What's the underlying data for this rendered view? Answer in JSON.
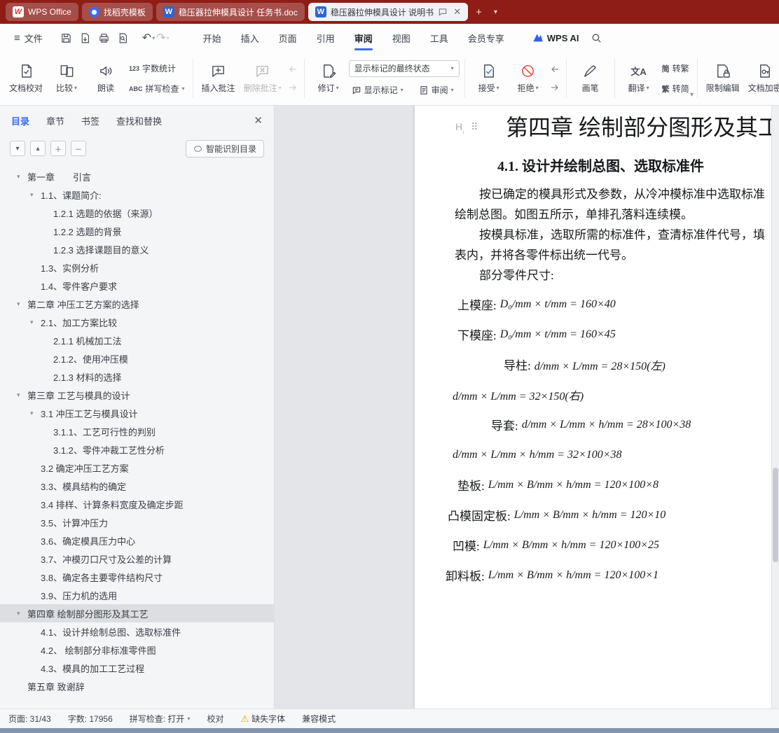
{
  "colors": {
    "titlebar": "#8e1d16",
    "accent_blue": "#3a6df0",
    "reject_red": "#e5443c",
    "selected_toc_bg": "#dcdee1",
    "warning_yellow": "#f0a500"
  },
  "titlebar": {
    "home_label": "WPS Office",
    "tabs": [
      "找稻壳模板",
      "稳压器拉伸模具设计 任务书.doc",
      "稳压器拉伸模具设计 说明书"
    ]
  },
  "menubar": {
    "file_label": "文件",
    "tabs": [
      "开始",
      "插入",
      "页面",
      "引用",
      "审阅",
      "视图",
      "工具",
      "会员专享"
    ],
    "wps_ai_label": "WPS AI"
  },
  "ribbon": {
    "doc_proof": "文档校对",
    "compare": "比较",
    "read_aloud": "朗读",
    "word_count_icon": "123",
    "word_count": "字数统计",
    "spell_icon": "ABC",
    "spell_check": "拼写检查",
    "insert_comment": "插入批注",
    "delete_comment": "删除批注",
    "track_changes": "修订",
    "markup_state": "显示标记的最终状态",
    "show_markup": "显示标记",
    "review": "审阅",
    "accept": "接受",
    "reject": "拒绝",
    "pen": "画笔",
    "translate_icon": "文A",
    "translate": "翻译",
    "jian": "简",
    "to_traditional": "转繁",
    "fan": "繁",
    "to_simplified": "转简",
    "restrict_edit": "限制编辑",
    "doc_encrypt": "文档加密"
  },
  "sidebar": {
    "tabs": [
      "目录",
      "章节",
      "书签",
      "查找和替换"
    ],
    "smart_toc_label": "智能识别目录",
    "toc": [
      "第一章　　引言",
      "1.1、课题简介:",
      "1.2.1 选题的依据（来源）",
      "1.2.2 选题的背景",
      "1.2.3 选择课题目的意义",
      "1.3、实例分析",
      "1.4、零件客户要求",
      "第二章 冲压工艺方案的选择",
      "2.1、加工方案比较",
      "2.1.1 机械加工法",
      "2.1.2、使用冲压模",
      "2.1.3 材料的选择",
      "第三章 工艺与模具的设计",
      "3.1 冲压工艺与模具设计",
      "3.1.1、工艺可行性的判别",
      "3.1.2、零件冲裁工艺性分析",
      "3.2 确定冲压工艺方案",
      "3.3、模具结构的确定",
      "3.4 排样、计算条料宽度及确定步距",
      "3.5、计算冲压力",
      "3.6、确定模具压力中心",
      "3.7、冲模刃口尺寸及公差的计算",
      "3.8、确定各主要零件结构尺寸",
      "3.9、压力机的选用",
      "第四章 绘制部分图形及其工艺",
      "4.1、设计并绘制总图、选取标准件",
      "4.2、 绘制部分非标准零件图",
      "4.3、模具的加工工艺过程",
      "第五章 致谢辞"
    ]
  },
  "document": {
    "title": "第四章  绘制部分图形及其工艺",
    "heading": "4.1.  设计并绘制总图、选取标准件",
    "para1": "按已确定的模具形式及参数，从冷冲模标准中选取标准",
    "para2": "绘制总图。如图五所示，单排孔落料连续模。",
    "para3": "按模具标准，选取所需的标准件，查清标准件代号，填",
    "para4": "表内，并将各零件标出统一代号。",
    "para5": "部分零件尺寸:",
    "specs": [
      {
        "label": "上模座:",
        "formula": "D₀/mm × t/mm = 160×40"
      },
      {
        "label": "下模座:",
        "formula": "D₀/mm × t/mm = 160×45"
      },
      {
        "label": "导柱:",
        "formula": "d/mm × L/mm = 28×150(左)"
      },
      {
        "label": "",
        "formula": "d/mm × L/mm = 32×150(右)"
      },
      {
        "label": "导套:",
        "formula": "d/mm × L/mm × h/mm = 28×100×38"
      },
      {
        "label": "",
        "formula": "d/mm × L/mm × h/mm = 32×100×38"
      },
      {
        "label": "垫板:",
        "formula": "L/mm × B/mm × h/mm = 120×100×8"
      },
      {
        "label": "凸模固定板:",
        "formula": "L/mm × B/mm × h/mm = 120×10"
      },
      {
        "label": "凹模:",
        "formula": "L/mm × B/mm × h/mm = 120×100×25"
      },
      {
        "label": "卸料板:",
        "formula": "L/mm × B/mm × h/mm = 120×100×1"
      }
    ]
  },
  "statusbar": {
    "page": "页面: 31/43",
    "words": "字数: 17956",
    "spell": "拼写检查: 打开",
    "proof": "校对",
    "missing_font": "缺失字体",
    "compat": "兼容模式"
  }
}
